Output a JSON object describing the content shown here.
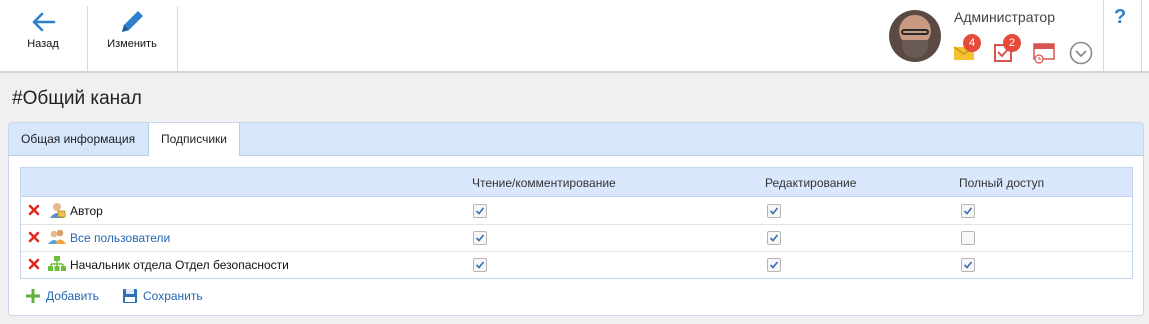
{
  "toolbar": {
    "back_label": "Назад",
    "edit_label": "Изменить"
  },
  "user": {
    "name": "Администратор",
    "mail_count": "4",
    "tasks_count": "2"
  },
  "help_label": "?",
  "page_title": "#Общий канал",
  "tabs": [
    {
      "label": "Общая информация",
      "active": false
    },
    {
      "label": "Подписчики",
      "active": true
    }
  ],
  "grid": {
    "columns": [
      "Чтение/комментирование",
      "Редактирование",
      "Полный доступ"
    ],
    "rows": [
      {
        "name": "Автор",
        "icon": "user-role-icon",
        "link": false,
        "read": true,
        "edit": true,
        "full": true
      },
      {
        "name": "Все пользователи",
        "icon": "users-group-icon",
        "link": true,
        "read": true,
        "edit": true,
        "full": false
      },
      {
        "name": "Начальник отдела Отдел безопасности",
        "icon": "org-structure-icon",
        "link": false,
        "read": true,
        "edit": true,
        "full": true
      }
    ]
  },
  "actions": {
    "add_label": "Добавить",
    "save_label": "Сохранить"
  },
  "colors": {
    "accent": "#2f7fcf",
    "badge": "#e64a3b",
    "link": "#2566b0",
    "header_bg": "#d9e8fc"
  }
}
